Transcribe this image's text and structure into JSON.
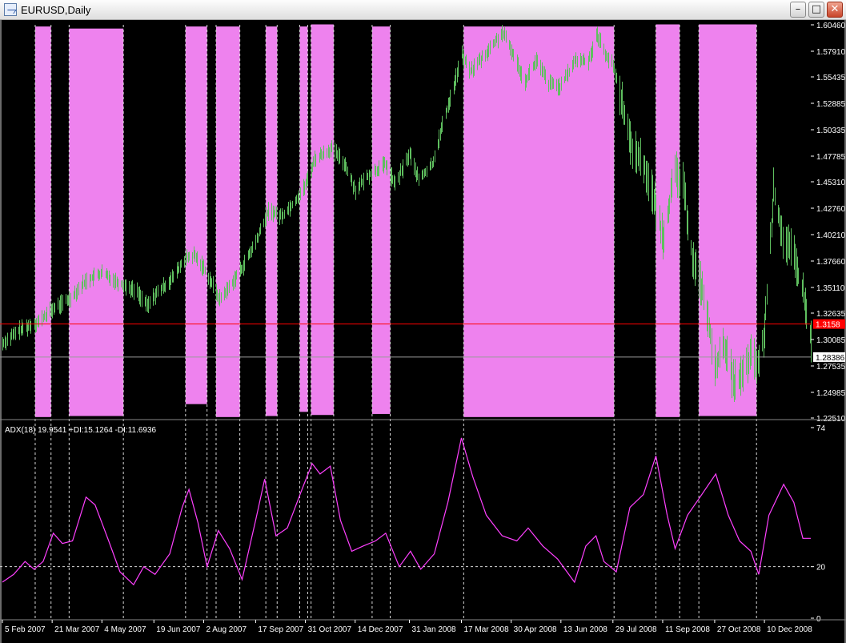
{
  "window": {
    "title": "EURUSD,Daily",
    "minimize_icon": "minimize-icon",
    "maximize_icon": "maximize-icon",
    "close_icon": "close-icon"
  },
  "colors": {
    "background": "#000000",
    "candle": "#5fbf5f",
    "highlight": "#ee82ee",
    "adx_line": "#ff40ff",
    "current_price_line": "#ff0000",
    "bid_line": "#9a9a9a"
  },
  "chart_data": [
    {
      "type": "bar",
      "symbol": "EURUSD",
      "timeframe": "Daily",
      "ylim": [
        1.2251,
        1.6046
      ],
      "y_ticks": [
        1.6046,
        1.5791,
        1.55435,
        1.52885,
        1.50335,
        1.47785,
        1.4531,
        1.4276,
        1.4021,
        1.3766,
        1.3511,
        1.32635,
        1.30085,
        1.27535,
        1.24985,
        1.2251
      ],
      "y_tick_labels": [
        "1.60460",
        "1.57910",
        "1.55435",
        "1.52885",
        "1.50335",
        "1.47785",
        "1.45310",
        "1.42760",
        "1.40210",
        "1.37660",
        "1.35110",
        "1.32635",
        "1.30085",
        "1.27535",
        "1.24985",
        "1.22510"
      ],
      "current_price": {
        "value": 1.3158,
        "label": "1.3158"
      },
      "bid_line": {
        "value": 1.2839,
        "label": "1.28386"
      },
      "price_path": [
        [
          "2007-02-05",
          1.297
        ],
        [
          "2007-02-20",
          1.31
        ],
        [
          "2007-03-09",
          1.318
        ],
        [
          "2007-03-21",
          1.33
        ],
        [
          "2007-04-05",
          1.34
        ],
        [
          "2007-04-20",
          1.358
        ],
        [
          "2007-05-04",
          1.365
        ],
        [
          "2007-05-20",
          1.355
        ],
        [
          "2007-06-04",
          1.347
        ],
        [
          "2007-06-13",
          1.333
        ],
        [
          "2007-06-19",
          1.343
        ],
        [
          "2007-07-05",
          1.36
        ],
        [
          "2007-07-16",
          1.378
        ],
        [
          "2007-07-24",
          1.382
        ],
        [
          "2007-08-02",
          1.37
        ],
        [
          "2007-08-16",
          1.34
        ],
        [
          "2007-08-22",
          1.348
        ],
        [
          "2007-09-05",
          1.37
        ],
        [
          "2007-09-17",
          1.395
        ],
        [
          "2007-09-28",
          1.425
        ],
        [
          "2007-10-10",
          1.42
        ],
        [
          "2007-10-22",
          1.435
        ],
        [
          "2007-10-31",
          1.45
        ],
        [
          "2007-11-08",
          1.475
        ],
        [
          "2007-11-23",
          1.485
        ],
        [
          "2007-12-05",
          1.47
        ],
        [
          "2007-12-14",
          1.445
        ],
        [
          "2007-12-26",
          1.46
        ],
        [
          "2008-01-10",
          1.47
        ],
        [
          "2008-01-18",
          1.45
        ],
        [
          "2008-01-31",
          1.48
        ],
        [
          "2008-02-08",
          1.455
        ],
        [
          "2008-02-20",
          1.47
        ],
        [
          "2008-03-03",
          1.52
        ],
        [
          "2008-03-10",
          1.545
        ],
        [
          "2008-03-17",
          1.575
        ],
        [
          "2008-03-25",
          1.56
        ],
        [
          "2008-04-10",
          1.58
        ],
        [
          "2008-04-22",
          1.597
        ],
        [
          "2008-04-30",
          1.58
        ],
        [
          "2008-05-12",
          1.55
        ],
        [
          "2008-05-22",
          1.57
        ],
        [
          "2008-06-02",
          1.548
        ],
        [
          "2008-06-13",
          1.545
        ],
        [
          "2008-06-25",
          1.57
        ],
        [
          "2008-07-07",
          1.57
        ],
        [
          "2008-07-15",
          1.595
        ],
        [
          "2008-07-23",
          1.575
        ],
        [
          "2008-07-29",
          1.565
        ],
        [
          "2008-08-06",
          1.53
        ],
        [
          "2008-08-13",
          1.49
        ],
        [
          "2008-08-25",
          1.47
        ],
        [
          "2008-09-01",
          1.445
        ],
        [
          "2008-09-11",
          1.4
        ],
        [
          "2008-09-22",
          1.462
        ],
        [
          "2008-09-29",
          1.45
        ],
        [
          "2008-10-07",
          1.38
        ],
        [
          "2008-10-17",
          1.345
        ],
        [
          "2008-10-27",
          1.275
        ],
        [
          "2008-11-05",
          1.295
        ],
        [
          "2008-11-12",
          1.26
        ],
        [
          "2008-11-20",
          1.265
        ],
        [
          "2008-11-28",
          1.285
        ],
        [
          "2008-12-05",
          1.275
        ],
        [
          "2008-12-10",
          1.31
        ],
        [
          "2008-12-18",
          1.445
        ],
        [
          "2008-12-26",
          1.4
        ],
        [
          "2009-01-05",
          1.38
        ],
        [
          "2009-01-13",
          1.345
        ],
        [
          "2009-01-20",
          1.3
        ]
      ],
      "highlight_bands": [
        {
          "from": "2007-03-06",
          "to": "2007-03-20",
          "low": 1.226,
          "high": 1.603
        },
        {
          "from": "2007-04-05",
          "to": "2007-05-23",
          "low": 1.227,
          "high": 1.601
        },
        {
          "from": "2007-07-17",
          "to": "2007-08-05",
          "low": 1.2385,
          "high": 1.603
        },
        {
          "from": "2007-08-13",
          "to": "2007-09-03",
          "low": 1.226,
          "high": 1.603
        },
        {
          "from": "2007-09-26",
          "to": "2007-10-06",
          "low": 1.227,
          "high": 1.603
        },
        {
          "from": "2007-10-26",
          "to": "2007-11-02",
          "low": 1.231,
          "high": 1.603
        },
        {
          "from": "2007-11-05",
          "to": "2007-11-25",
          "low": 1.228,
          "high": 1.605
        },
        {
          "from": "2007-12-29",
          "to": "2008-01-14",
          "low": 1.229,
          "high": 1.603
        },
        {
          "from": "2008-03-19",
          "to": "2008-07-30",
          "low": 1.226,
          "high": 1.603
        },
        {
          "from": "2008-09-05",
          "to": "2008-09-26",
          "low": 1.226,
          "high": 1.605
        },
        {
          "from": "2008-10-13",
          "to": "2008-12-03",
          "low": 1.227,
          "high": 1.605
        }
      ]
    },
    {
      "type": "line",
      "indicator_label": "ADX(18) 19.9541 +DI:15.1264 -DI:11.6936",
      "ylim": [
        0,
        74
      ],
      "y_ticks": [
        74,
        20,
        0
      ],
      "y_tick_labels": [
        "74",
        "20",
        "0"
      ],
      "reference_line": 20,
      "x_tick_labels": [
        "5 Feb 2007",
        "21 Mar 2007",
        "4 May 2007",
        "19 Jun 2007",
        "2 Aug 2007",
        "17 Sep 2007",
        "31 Oct 2007",
        "14 Dec 2007",
        "31 Jan 2008",
        "17 Mar 2008",
        "30 Apr 2008",
        "13 Jun 2008",
        "29 Jul 2008",
        "11 Sep 2008",
        "27 Oct 2008",
        "10 Dec 2008"
      ],
      "x_tick_dates": [
        "2007-02-05",
        "2007-03-21",
        "2007-05-04",
        "2007-06-19",
        "2007-08-02",
        "2007-09-17",
        "2007-10-31",
        "2007-12-14",
        "2008-01-31",
        "2008-03-17",
        "2008-04-30",
        "2008-06-13",
        "2008-07-29",
        "2008-09-11",
        "2008-10-27",
        "2008-12-10"
      ],
      "adx_path": [
        [
          "2007-02-05",
          14
        ],
        [
          "2007-02-15",
          17
        ],
        [
          "2007-02-25",
          22
        ],
        [
          "2007-03-05",
          19
        ],
        [
          "2007-03-13",
          22
        ],
        [
          "2007-03-22",
          33
        ],
        [
          "2007-03-30",
          29
        ],
        [
          "2007-04-08",
          30
        ],
        [
          "2007-04-20",
          47
        ],
        [
          "2007-04-28",
          44
        ],
        [
          "2007-05-10",
          30
        ],
        [
          "2007-05-20",
          18
        ],
        [
          "2007-06-01",
          13
        ],
        [
          "2007-06-10",
          20
        ],
        [
          "2007-06-20",
          17
        ],
        [
          "2007-07-03",
          25
        ],
        [
          "2007-07-14",
          43
        ],
        [
          "2007-07-20",
          50
        ],
        [
          "2007-07-28",
          37
        ],
        [
          "2007-08-05",
          20
        ],
        [
          "2007-08-15",
          34
        ],
        [
          "2007-08-25",
          27
        ],
        [
          "2007-09-05",
          15
        ],
        [
          "2007-09-17",
          38
        ],
        [
          "2007-09-25",
          54
        ],
        [
          "2007-10-05",
          32
        ],
        [
          "2007-10-15",
          35
        ],
        [
          "2007-10-28",
          50
        ],
        [
          "2007-11-06",
          60
        ],
        [
          "2007-11-13",
          56
        ],
        [
          "2007-11-22",
          59
        ],
        [
          "2007-12-01",
          38
        ],
        [
          "2007-12-11",
          26
        ],
        [
          "2007-12-21",
          28
        ],
        [
          "2008-01-01",
          30
        ],
        [
          "2008-01-10",
          33
        ],
        [
          "2008-01-22",
          20
        ],
        [
          "2008-02-01",
          26
        ],
        [
          "2008-02-10",
          19
        ],
        [
          "2008-02-22",
          25
        ],
        [
          "2008-03-05",
          45
        ],
        [
          "2008-03-17",
          70
        ],
        [
          "2008-03-27",
          55
        ],
        [
          "2008-04-08",
          40
        ],
        [
          "2008-04-22",
          32
        ],
        [
          "2008-05-05",
          30
        ],
        [
          "2008-05-15",
          35
        ],
        [
          "2008-05-28",
          28
        ],
        [
          "2008-06-10",
          23
        ],
        [
          "2008-06-25",
          14
        ],
        [
          "2008-07-05",
          28
        ],
        [
          "2008-07-14",
          32
        ],
        [
          "2008-07-21",
          22
        ],
        [
          "2008-08-01",
          18
        ],
        [
          "2008-08-13",
          43
        ],
        [
          "2008-08-25",
          48
        ],
        [
          "2008-09-05",
          63
        ],
        [
          "2008-09-15",
          40
        ],
        [
          "2008-09-22",
          27
        ],
        [
          "2008-10-03",
          40
        ],
        [
          "2008-10-14",
          47
        ],
        [
          "2008-10-28",
          56
        ],
        [
          "2008-11-08",
          40
        ],
        [
          "2008-11-18",
          30
        ],
        [
          "2008-11-28",
          26
        ],
        [
          "2008-12-05",
          17
        ],
        [
          "2008-12-14",
          40
        ],
        [
          "2008-12-27",
          52
        ],
        [
          "2009-01-05",
          45
        ],
        [
          "2009-01-13",
          31
        ],
        [
          "2009-01-20",
          31
        ]
      ]
    }
  ]
}
